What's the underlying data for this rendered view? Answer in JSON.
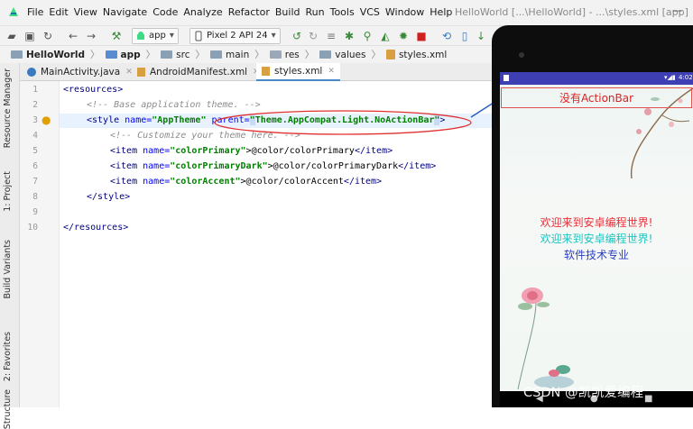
{
  "menubar": {
    "items": [
      "File",
      "Edit",
      "View",
      "Navigate",
      "Code",
      "Analyze",
      "Refactor",
      "Build",
      "Run",
      "Tools",
      "VCS",
      "Window",
      "Help"
    ],
    "window_title": "HelloWorld [...\\HelloWorld] - ...\\styles.xml [app]",
    "minimize": "—"
  },
  "toolbar": {
    "run_config": "app",
    "device": "Pixel 2 API 24"
  },
  "breadcrumb": [
    "HelloWorld",
    "app",
    "src",
    "main",
    "res",
    "values",
    "styles.xml"
  ],
  "left_strip": {
    "tabs": [
      "Resource Manager",
      "1: Project",
      "Build Variants",
      "2: Favorites",
      "Structure"
    ]
  },
  "editor_tabs": [
    {
      "label": "MainActivity.java",
      "active": false
    },
    {
      "label": "AndroidManifest.xml",
      "active": false
    },
    {
      "label": "styles.xml",
      "active": true
    }
  ],
  "code": {
    "line_numbers": [
      "1",
      "2",
      "3",
      "4",
      "5",
      "6",
      "7",
      "8",
      "9",
      "10"
    ],
    "l1_open": "<resources>",
    "l2_comment": "<!-- Base application theme. -->",
    "l3_tag": "<style",
    "l3_name_attr": "name=",
    "l3_name_val": "\"AppTheme\"",
    "l3_parent_attr": "parent=",
    "l3_q1": "\"",
    "l3_parent_val": "Theme.AppCompat.Light.NoActionBar",
    "l3_q2": "\"",
    "l3_close": ">",
    "l4_comment": "<!-- Customize your theme here. -->",
    "items": [
      {
        "open": "<item",
        "attr": "name=",
        "val": "\"colorPrimary\"",
        "body": ">@color/colorPrimary",
        "close": "</item>",
        "color": "#3f51b5"
      },
      {
        "open": "<item",
        "attr": "name=",
        "val": "\"colorPrimaryDark\"",
        "body": ">@color/colorPrimaryDark",
        "close": "</item>",
        "color": "#303f9f"
      },
      {
        "open": "<item",
        "attr": "name=",
        "val": "\"colorAccent\"",
        "body": ">@color/colorAccent",
        "close": "</item>",
        "color": "#40c4b0"
      }
    ],
    "l8_close": "</style>",
    "l10_close": "</resources>"
  },
  "phone": {
    "clock": "4:02",
    "no_actionbar_label": "没有ActionBar",
    "welcome_1": "欢迎来到安卓编程世界!",
    "welcome_2": "欢迎来到安卓编程世界!",
    "welcome_3": "软件技术专业",
    "colors": {
      "status_bar": "#3d3fb2",
      "label_red": "#e02020",
      "welcome_red": "#e8303a",
      "welcome_teal": "#1fc4c0",
      "welcome_blue": "#2b3fc0"
    }
  },
  "watermark": "CSDN @凯凯爱编程"
}
